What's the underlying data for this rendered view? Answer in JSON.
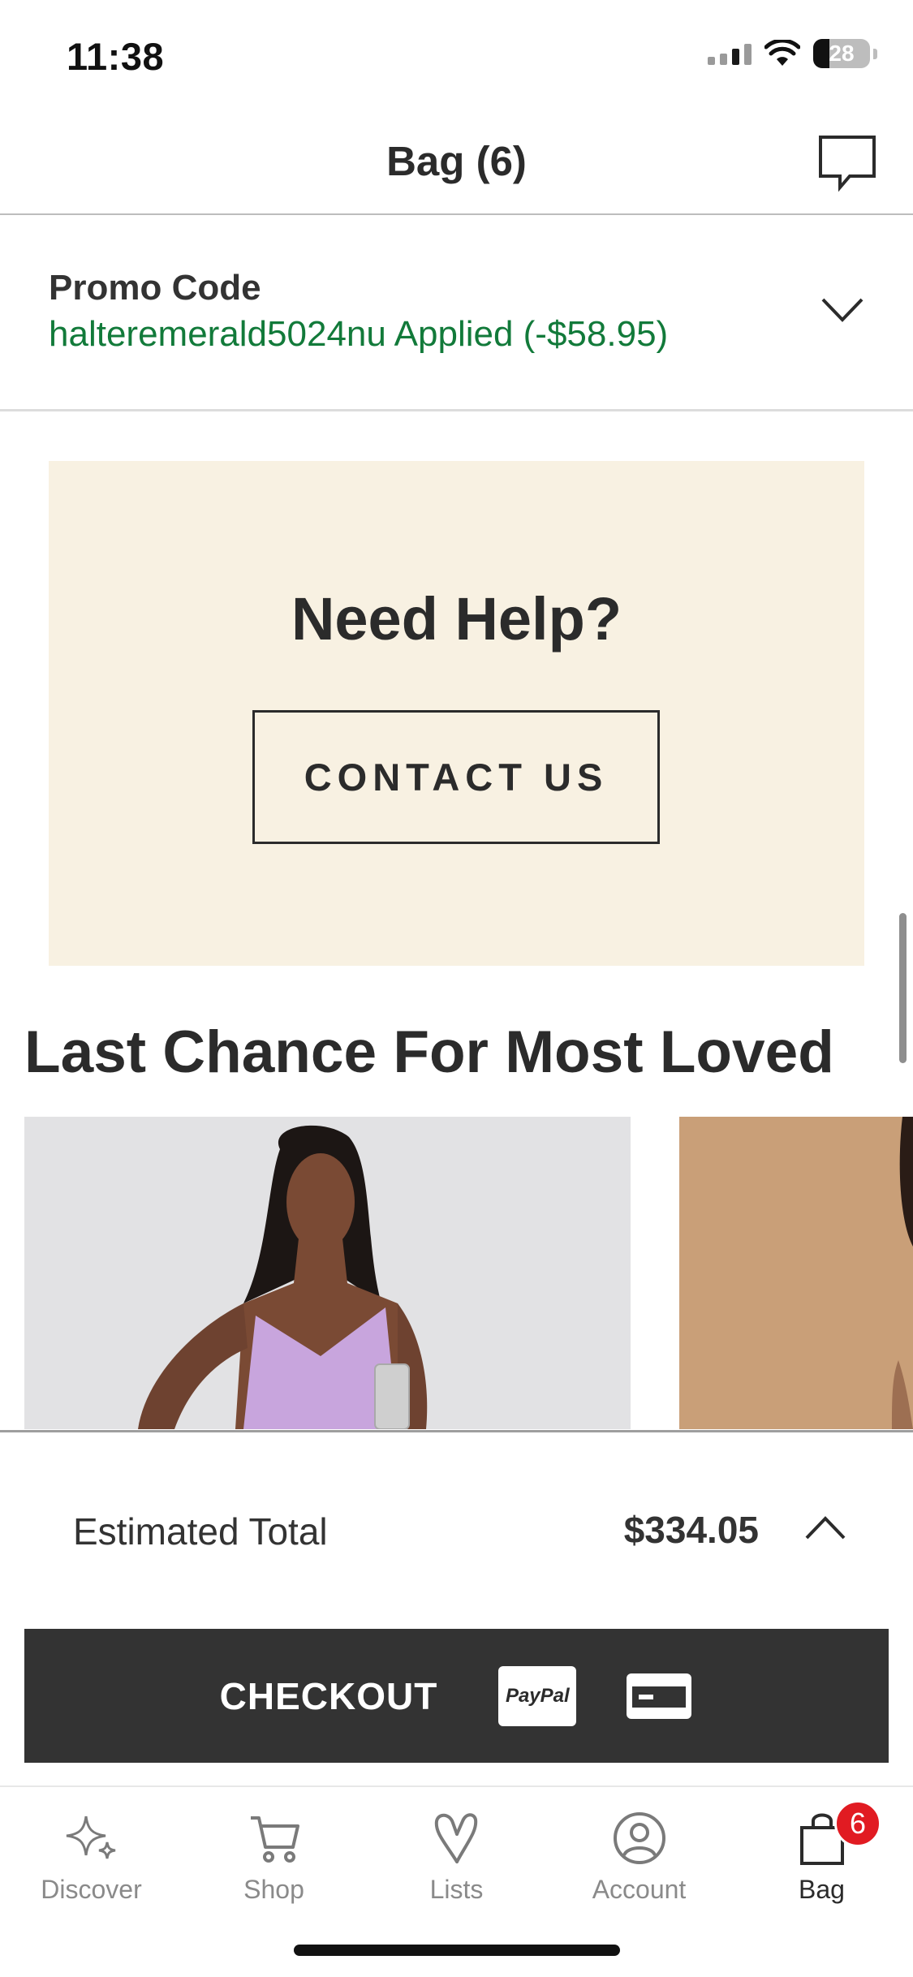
{
  "status_bar": {
    "time": "11:38",
    "battery": "28"
  },
  "header": {
    "title": "Bag (6)",
    "chat_icon": "chat-bubble-icon"
  },
  "promo": {
    "label": "Promo Code",
    "status": "halteremerald5024nu Applied (-$58.95)",
    "status_color": "#127a3a"
  },
  "help": {
    "title": "Need Help?",
    "contact_button": "CONTACT US",
    "background": "#f8f1e2"
  },
  "section": {
    "title": "Last Chance For Most Loved"
  },
  "summary": {
    "total_label": "Estimated Total",
    "total_value": "$334.05",
    "checkout_label": "CHECKOUT",
    "paypal_label": "PayPal"
  },
  "tab_bar": {
    "items": [
      {
        "label": "Discover",
        "icon": "sparkle-icon"
      },
      {
        "label": "Shop",
        "icon": "cart-icon"
      },
      {
        "label": "Lists",
        "icon": "heart-icon"
      },
      {
        "label": "Account",
        "icon": "user-icon"
      },
      {
        "label": "Bag",
        "icon": "bag-icon",
        "badge": "6",
        "active": true
      }
    ]
  }
}
